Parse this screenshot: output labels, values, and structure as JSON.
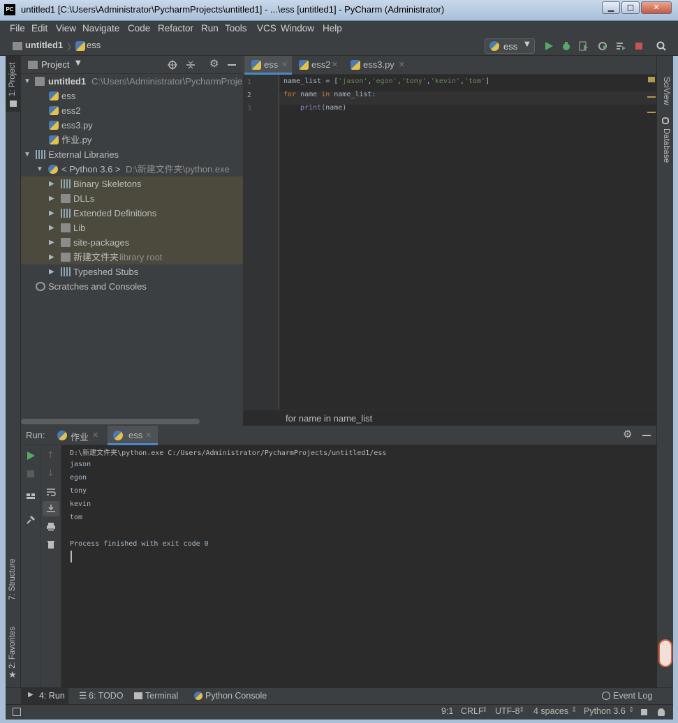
{
  "window": {
    "title": "untitled1 [C:\\Users\\Administrator\\PycharmProjects\\untitled1] - ...\\ess [untitled1] - PyCharm (Administrator)",
    "minimize": "▁",
    "maximize": "□",
    "close": "✕"
  },
  "menu": [
    "File",
    "Edit",
    "View",
    "Navigate",
    "Code",
    "Refactor",
    "Run",
    "Tools",
    "VCS",
    "Window",
    "Help"
  ],
  "breadcrumbs": {
    "project": "untitled1",
    "file": "ess"
  },
  "run_config": "ess",
  "left_strip": {
    "project": "1: Project",
    "structure": "7: Structure",
    "favorites": "2: Favorites"
  },
  "right_strip": {
    "sciview": "SciView",
    "database": "Database"
  },
  "project_panel": {
    "title": "Project",
    "tree": [
      {
        "label": "untitled1",
        "extra": "C:\\Users\\Administrator\\PycharmProje",
        "icon": "folder-icon",
        "arrow": "▼",
        "bold": true
      },
      {
        "label": "ess",
        "extra": "",
        "icon": "py-file-icon",
        "arrow": ""
      },
      {
        "label": "ess2",
        "extra": "",
        "icon": "py-file-icon",
        "arrow": ""
      },
      {
        "label": "ess3.py",
        "extra": "",
        "icon": "py-file-icon",
        "arrow": ""
      },
      {
        "label": "作业.py",
        "extra": "",
        "icon": "py-file-icon",
        "arrow": ""
      },
      {
        "label": "External Libraries",
        "extra": "",
        "icon": "library-icon",
        "arrow": "▼"
      },
      {
        "label": "< Python 3.6 >",
        "extra": "D:\\新建文件夹\\python.exe",
        "icon": "python-icon",
        "arrow": "▼"
      },
      {
        "label": "Binary Skeletons",
        "extra": "",
        "icon": "library-icon",
        "arrow": "▶"
      },
      {
        "label": "DLLs",
        "extra": "",
        "icon": "folder-icon",
        "arrow": "▶"
      },
      {
        "label": "Extended Definitions",
        "extra": "",
        "icon": "library-icon",
        "arrow": "▶"
      },
      {
        "label": "Lib",
        "extra": "",
        "icon": "folder-icon",
        "arrow": "▶"
      },
      {
        "label": "site-packages",
        "extra": "",
        "icon": "folder-icon",
        "arrow": "▶"
      },
      {
        "label": "新建文件夹",
        "extra": "library root",
        "icon": "folder-icon",
        "arrow": "▶"
      },
      {
        "label": "Typeshed Stubs",
        "extra": "",
        "icon": "library-icon",
        "arrow": "▶"
      },
      {
        "label": "Scratches and Consoles",
        "extra": "",
        "icon": "scratches-icon",
        "arrow": ""
      }
    ]
  },
  "editor": {
    "tabs": [
      {
        "label": "ess",
        "close": "✕"
      },
      {
        "label": "ess2",
        "close": "✕"
      },
      {
        "label": "ess3.py",
        "close": "✕"
      }
    ],
    "line_numbers": [
      "1",
      "2",
      "3"
    ],
    "code": {
      "l1_a": "name_list = [",
      "l1_s1": "'jason'",
      "l1_s2": "'egon'",
      "l1_s3": "'tony'",
      "l1_s4": "'kevin'",
      "l1_s5": "'tom'",
      "comma": ",",
      "l1_end": "]",
      "l2_for": "for",
      "l2_a": " name ",
      "l2_in": "in",
      "l2_b": " name_list:",
      "l3_print": "print",
      "l3_args": "(name)"
    },
    "breadcrumb": "for name in name_list"
  },
  "run_panel": {
    "label": "Run:",
    "tabs": [
      {
        "label": "作业",
        "close": "✕"
      },
      {
        "label": "ess",
        "close": "✕"
      }
    ],
    "output": [
      "D:\\新建文件夹\\python.exe C:/Users/Administrator/PycharmProjects/untitled1/ess",
      "jason",
      "egon",
      "tony",
      "kevin",
      "tom",
      "",
      "Process finished with exit code 0"
    ]
  },
  "bottom_tools": [
    {
      "label": "4: Run"
    },
    {
      "label": "6: TODO"
    },
    {
      "label": "Terminal"
    },
    {
      "label": "Python Console"
    }
  ],
  "event_log": "Event Log",
  "status": {
    "position": "9:1",
    "line_sep": "CRLF",
    "encoding": "UTF-8",
    "indent": "4 spaces",
    "interpreter": "Python 3.6"
  },
  "colors": {
    "run_green": "#59a869",
    "debug_green": "#6a8759",
    "stop_red": "#c75450",
    "tab_underline": "#4a88c7",
    "keyword": "#cc7832",
    "string": "#6a8759",
    "builtin": "#8888c6"
  }
}
